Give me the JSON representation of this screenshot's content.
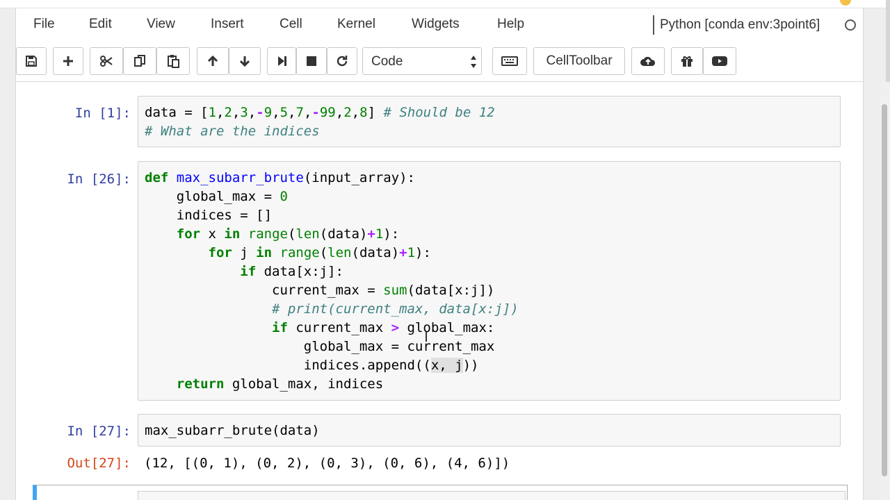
{
  "menubar": {
    "items": [
      "File",
      "Edit",
      "View",
      "Insert",
      "Cell",
      "Kernel",
      "Widgets",
      "Help"
    ],
    "kernel_name": "Python [conda env:3point6]"
  },
  "toolbar": {
    "cell_type": "Code",
    "celltoolbar_label": "CellToolbar",
    "icons": [
      "save-icon",
      "plus-icon",
      "cut-icon",
      "copy-icon",
      "paste-icon",
      "arrow-up-icon",
      "arrow-down-icon",
      "step-forward-icon",
      "stop-icon",
      "restart-icon",
      "keyboard-icon",
      "cloud-upload-icon",
      "gift-icon",
      "youtube-icon"
    ]
  },
  "cells": [
    {
      "prompt": "In [1]:",
      "lines": [
        "data = [1,2,3,-9,5,7,-99,2,8] # Should be 12",
        "# What are the indices"
      ]
    },
    {
      "prompt": "In [26]:",
      "lines": [
        "def max_subarr_brute(input_array):",
        "    global_max = 0",
        "    indices = []",
        "    for x in range(len(data)+1):",
        "        for j in range(len(data)+1):",
        "            if data[x:j]:",
        "                current_max = sum(data[x:j])",
        "                # print(current_max, data[x:j])",
        "                if current_max > global_max:",
        "                    global_max = current_max",
        "                    indices.append((x, j))",
        "    return global_max, indices"
      ]
    },
    {
      "prompt": "In [27]:",
      "lines": [
        "max_subarr_brute(data)"
      ],
      "out_prompt": "Out[27]:",
      "output": "(12, [(0, 1), (0, 2), (0, 3), (0, 6), (4, 6)])"
    }
  ]
}
